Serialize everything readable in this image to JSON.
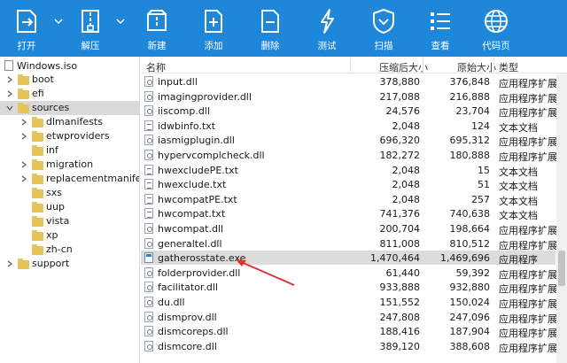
{
  "toolbar": {
    "buttons": [
      {
        "label": "打开",
        "icon": "open-icon"
      },
      {
        "label": "解压",
        "icon": "extract-icon"
      },
      {
        "label": "新建",
        "icon": "new-archive-icon"
      },
      {
        "label": "添加",
        "icon": "add-icon"
      },
      {
        "label": "删除",
        "icon": "delete-icon"
      },
      {
        "label": "测试",
        "icon": "test-icon"
      },
      {
        "label": "扫描",
        "icon": "scan-shield-icon"
      },
      {
        "label": "查看",
        "icon": "view-list-icon"
      },
      {
        "label": "代码页",
        "icon": "codepage-globe-icon"
      }
    ]
  },
  "tree": {
    "root": "Windows.iso",
    "items": [
      {
        "label": "boot",
        "level": 1,
        "expandable": true
      },
      {
        "label": "efi",
        "level": 1,
        "expandable": true
      },
      {
        "label": "sources",
        "level": 1,
        "expandable": true,
        "expanded": true,
        "selected": true
      },
      {
        "label": "dlmanifests",
        "level": 2,
        "expandable": true
      },
      {
        "label": "etwproviders",
        "level": 2,
        "expandable": true
      },
      {
        "label": "inf",
        "level": 2,
        "expandable": false
      },
      {
        "label": "migration",
        "level": 2,
        "expandable": true
      },
      {
        "label": "replacementmanifests",
        "level": 2,
        "expandable": true
      },
      {
        "label": "sxs",
        "level": 2,
        "expandable": false
      },
      {
        "label": "uup",
        "level": 2,
        "expandable": false
      },
      {
        "label": "vista",
        "level": 2,
        "expandable": false
      },
      {
        "label": "xp",
        "level": 2,
        "expandable": false
      },
      {
        "label": "zh-cn",
        "level": 2,
        "expandable": false
      },
      {
        "label": "support",
        "level": 1,
        "expandable": true
      }
    ]
  },
  "list": {
    "headers": {
      "name": "名称",
      "size": "压缩后大小",
      "orig": "原始大小",
      "type": "类型"
    },
    "rows": [
      {
        "name": "input.dll",
        "size": "378,880",
        "orig": "376,848",
        "type": "应用程序扩展",
        "kind": "dll"
      },
      {
        "name": "imagingprovider.dll",
        "size": "217,088",
        "orig": "216,888",
        "type": "应用程序扩展",
        "kind": "dll"
      },
      {
        "name": "iiscomp.dll",
        "size": "24,576",
        "orig": "23,704",
        "type": "应用程序扩展",
        "kind": "dll"
      },
      {
        "name": "idwbinfo.txt",
        "size": "2,048",
        "orig": "124",
        "type": "文本文档",
        "kind": "txt"
      },
      {
        "name": "iasmigplugin.dll",
        "size": "696,320",
        "orig": "695,312",
        "type": "应用程序扩展",
        "kind": "dll"
      },
      {
        "name": "hypervcomplcheck.dll",
        "size": "182,272",
        "orig": "180,888",
        "type": "应用程序扩展",
        "kind": "dll"
      },
      {
        "name": "hwexcludePE.txt",
        "size": "2,048",
        "orig": "15",
        "type": "文本文档",
        "kind": "txt"
      },
      {
        "name": "hwexclude.txt",
        "size": "2,048",
        "orig": "51",
        "type": "文本文档",
        "kind": "txt"
      },
      {
        "name": "hwcompatPE.txt",
        "size": "2,048",
        "orig": "257",
        "type": "文本文档",
        "kind": "txt"
      },
      {
        "name": "hwcompat.txt",
        "size": "741,376",
        "orig": "740,638",
        "type": "文本文档",
        "kind": "txt"
      },
      {
        "name": "hwcompat.dll",
        "size": "200,704",
        "orig": "198,664",
        "type": "应用程序扩展",
        "kind": "dll"
      },
      {
        "name": "generaltel.dll",
        "size": "811,008",
        "orig": "810,512",
        "type": "应用程序扩展",
        "kind": "dll"
      },
      {
        "name": "gatherosstate.exe",
        "size": "1,470,464",
        "orig": "1,469,696",
        "type": "应用程序",
        "kind": "exe",
        "selected": true
      },
      {
        "name": "folderprovider.dll",
        "size": "61,440",
        "orig": "59,392",
        "type": "应用程序扩展",
        "kind": "dll"
      },
      {
        "name": "facilitator.dll",
        "size": "933,888",
        "orig": "932,880",
        "type": "应用程序扩展",
        "kind": "dll"
      },
      {
        "name": "du.dll",
        "size": "151,552",
        "orig": "150,024",
        "type": "应用程序扩展",
        "kind": "dll"
      },
      {
        "name": "dismprov.dll",
        "size": "247,808",
        "orig": "247,096",
        "type": "应用程序扩展",
        "kind": "dll"
      },
      {
        "name": "dismcoreps.dll",
        "size": "188,416",
        "orig": "187,904",
        "type": "应用程序扩展",
        "kind": "dll"
      },
      {
        "name": "dismcore.dll",
        "size": "389,120",
        "orig": "388,608",
        "type": "应用程序扩展",
        "kind": "dll"
      }
    ]
  },
  "colors": {
    "toolbar_bg": "#1f87d9",
    "selection": "#dcdcdc",
    "folder": "#e8c35a",
    "annotation_arrow": "#e03030"
  }
}
